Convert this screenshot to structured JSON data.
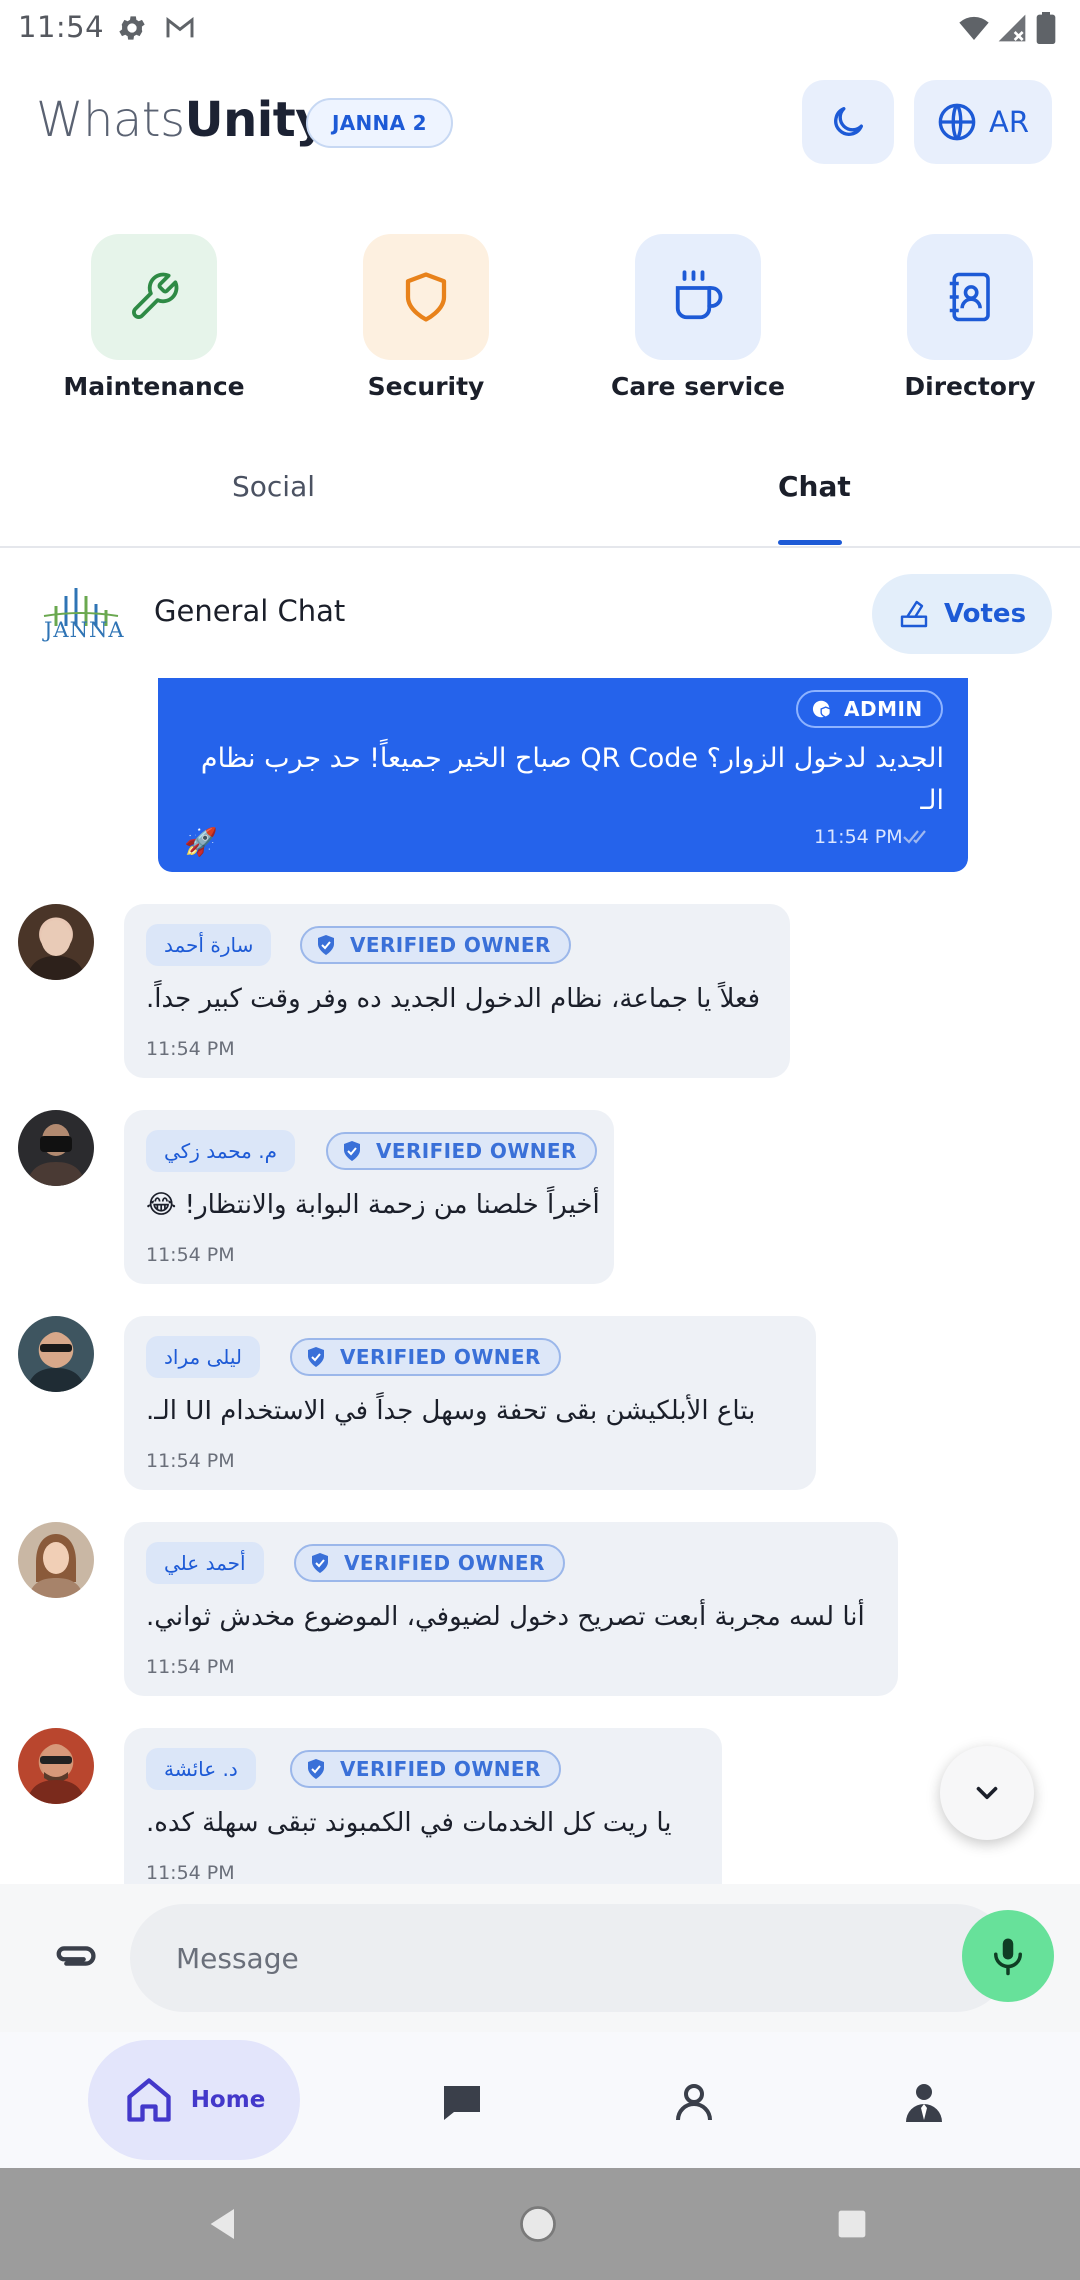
{
  "status_bar": {
    "time": "11:54"
  },
  "header": {
    "logo_part1": "Whats",
    "logo_part2": "Unity",
    "community_tag": "JANNA 2",
    "language_label": "AR"
  },
  "services": [
    {
      "label": "Maintenance",
      "bg": "#e6f4ea",
      "icon": "wrench-icon"
    },
    {
      "label": "Security",
      "bg": "#fdf0e0",
      "icon": "shield-icon"
    },
    {
      "label": "Care service",
      "bg": "#e6eefc",
      "icon": "coffee-icon"
    },
    {
      "label": "Directory",
      "bg": "#e6eefc",
      "icon": "contacts-book-icon"
    }
  ],
  "tabs": [
    {
      "label": "Social",
      "active": false
    },
    {
      "label": "Chat",
      "active": true
    }
  ],
  "chat_header": {
    "logo_text": "JANNA",
    "title": "General Chat",
    "votes_label": "Votes"
  },
  "admin_message": {
    "badge": "ADMIN",
    "text_line1": "الجديد لدخول الزوار؟ QR Code صباح الخير جميعاً! حد جرب نظام الـ",
    "text_line2": "🚀",
    "time": "11:54 PM"
  },
  "messages": [
    {
      "name": "سارة أحمد",
      "badge": "VERIFIED OWNER",
      "text": "فعلاً يا جماعة، نظام الدخول الجديد ده وفر وقت كبير جداً.",
      "time": "11:54 PM"
    },
    {
      "name": "م. محمد زكي",
      "badge": "VERIFIED OWNER",
      "text": "أخيراً خلصنا من زحمة البوابة والانتظار! 😂",
      "time": "11:54 PM"
    },
    {
      "name": "ليلى مراد",
      "badge": "VERIFIED OWNER",
      "text": "بتاع الأبلكيشن بقى تحفة وسهل جداً في الاستخدام UI الـ.",
      "time": "11:54 PM"
    },
    {
      "name": "أحمد علي",
      "badge": "VERIFIED OWNER",
      "text": "أنا لسه مجربة أبعت تصريح دخول لضيوفي، الموضوع مخدش ثواني.",
      "time": "11:54 PM"
    },
    {
      "name": "د. عائشة",
      "badge": "VERIFIED OWNER",
      "text": "يا ريت كل الخدمات في الكمبوند تبقى سهلة كده.",
      "time": "11:54 PM"
    }
  ],
  "composer": {
    "placeholder": "Message"
  },
  "bottom_nav": {
    "home_label": "Home"
  },
  "colors": {
    "accent": "#1d5ad6",
    "admin_bubble": "#2563eb",
    "mic": "#67e19a",
    "home_pill": "#e3e5fb"
  }
}
